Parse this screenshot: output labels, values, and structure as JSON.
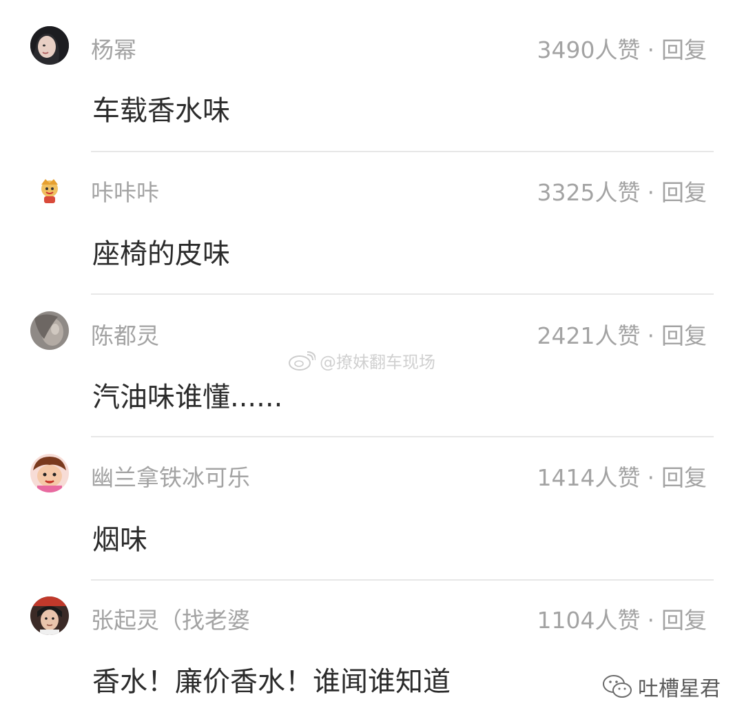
{
  "comments": [
    {
      "username": "杨幂",
      "likes": "3490人赞",
      "separator": "·",
      "reply": "回复",
      "content": "车载香水味",
      "avatar": "avatar-woman-dark-hair"
    },
    {
      "username": "咔咔咔",
      "likes": "3325人赞",
      "separator": "·",
      "reply": "回复",
      "content": "座椅的皮味",
      "avatar": "avatar-cartoon-monkey"
    },
    {
      "username": "陈都灵",
      "likes": "2421人赞",
      "separator": "·",
      "reply": "回复",
      "content": "汽油味谁懂......",
      "avatar": "avatar-blurred-portrait"
    },
    {
      "username": "幽兰拿铁冰可乐",
      "likes": "1414人赞",
      "separator": "·",
      "reply": "回复",
      "content": "烟味",
      "avatar": "avatar-cartoon-boy"
    },
    {
      "username": "张起灵（找老婆",
      "likes": "1104人赞",
      "separator": "·",
      "reply": "回复",
      "content": "香水！廉价香水！谁闻谁知道",
      "avatar": "avatar-person-photo"
    }
  ],
  "watermark": {
    "text": "@撩妹翻车现场",
    "icon": "weibo-logo-icon"
  },
  "corner_mark": {
    "text": "吐槽星君",
    "icon": "wechat-logo-icon"
  }
}
